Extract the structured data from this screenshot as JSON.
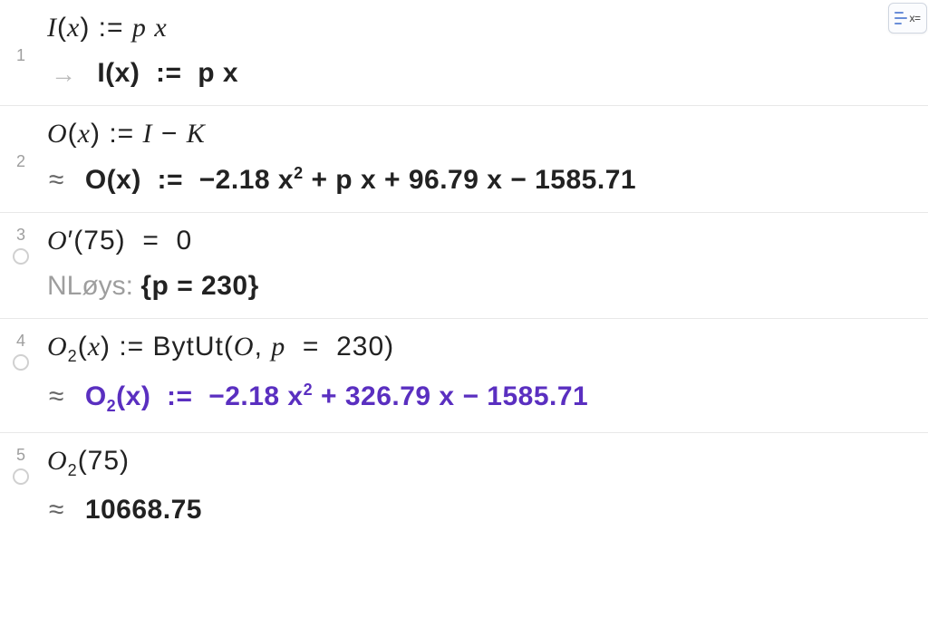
{
  "toolbar": {
    "keyboard_tab_label": "x="
  },
  "cells": [
    {
      "n": "1",
      "input": "I(x) := p x",
      "out_prefix_type": "arrow",
      "output": "I(x)  :=  p x",
      "output_class": ""
    },
    {
      "n": "2",
      "input": "O(x) := I − K",
      "out_prefix_type": "approx",
      "output": "O(x)  :=  −2.18 x² + p x + 96.79 x − 1585.71",
      "output_class": ""
    },
    {
      "n": "3",
      "input": "O′(75)  =  0",
      "out_prefix_type": "nloys",
      "out_prefix_label": "NLøys:  ",
      "output": "{p = 230}",
      "output_class": ""
    },
    {
      "n": "4",
      "input": "O₂(x) := BytUt(O, p  =  230)",
      "out_prefix_type": "approx",
      "output": "O₂(x)  :=  −2.18 x² + 326.79 x − 1585.71",
      "output_class": "purple"
    },
    {
      "n": "5",
      "input": "O₂(75)",
      "out_prefix_type": "approx",
      "output": "10668.75",
      "output_class": ""
    }
  ]
}
